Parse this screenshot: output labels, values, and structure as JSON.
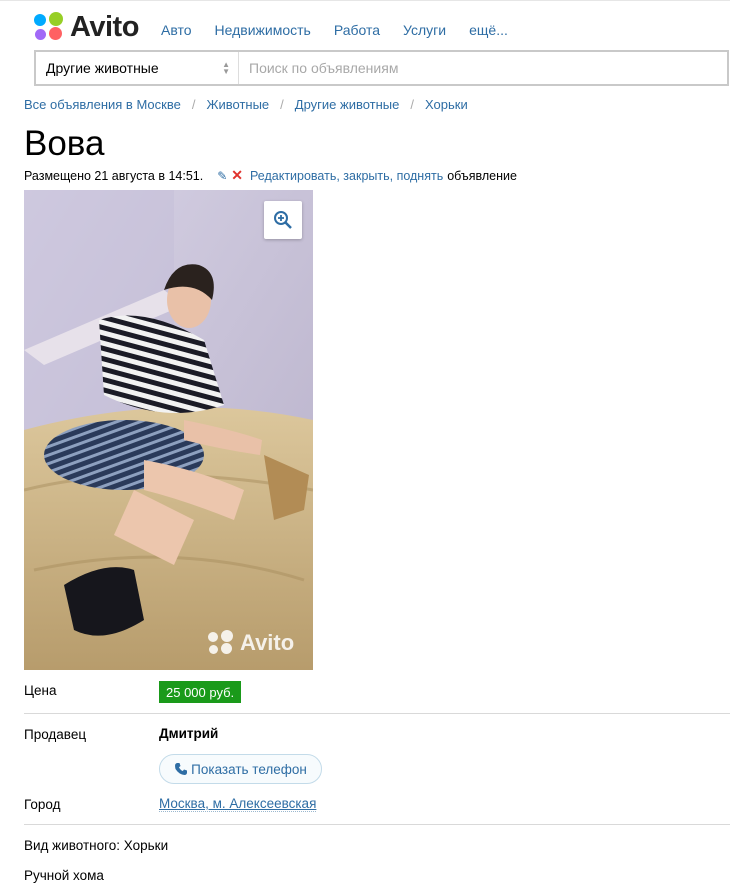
{
  "brand": {
    "name": "Avito"
  },
  "nav": [
    "Авто",
    "Недвижимость",
    "Работа",
    "Услуги",
    "ещё..."
  ],
  "search": {
    "category": "Другие животные",
    "placeholder": "Поиск по объявлениям"
  },
  "breadcrumb": [
    "Все объявления в Москве",
    "Животные",
    "Другие животные",
    "Хорьки"
  ],
  "listing": {
    "title": "Вова",
    "posted": "Размещено 21 августа в 14:51.",
    "edit_link": "Редактировать, закрыть, поднять",
    "edit_tail": "объявление",
    "watermark": "Avito"
  },
  "details": {
    "price_label": "Цена",
    "price": "25 000 руб.",
    "seller_label": "Продавец",
    "seller": "Дмитрий",
    "phone_button": "Показать телефон",
    "city_label": "Город",
    "city": "Москва, м. Алексеевская"
  },
  "description": [
    "Вид животного: Хорьки",
    "Ручной хома"
  ],
  "icons": {
    "logo": "avito-logo-icon",
    "select_arrows": "select-arrows-icon",
    "edit": "pencil-icon",
    "close": "close-icon",
    "zoom": "zoom-in-icon",
    "phone": "phone-icon"
  },
  "colors": {
    "link": "#2e6da4",
    "price_badge": "#1a9a1a",
    "close": "#e0322d"
  }
}
